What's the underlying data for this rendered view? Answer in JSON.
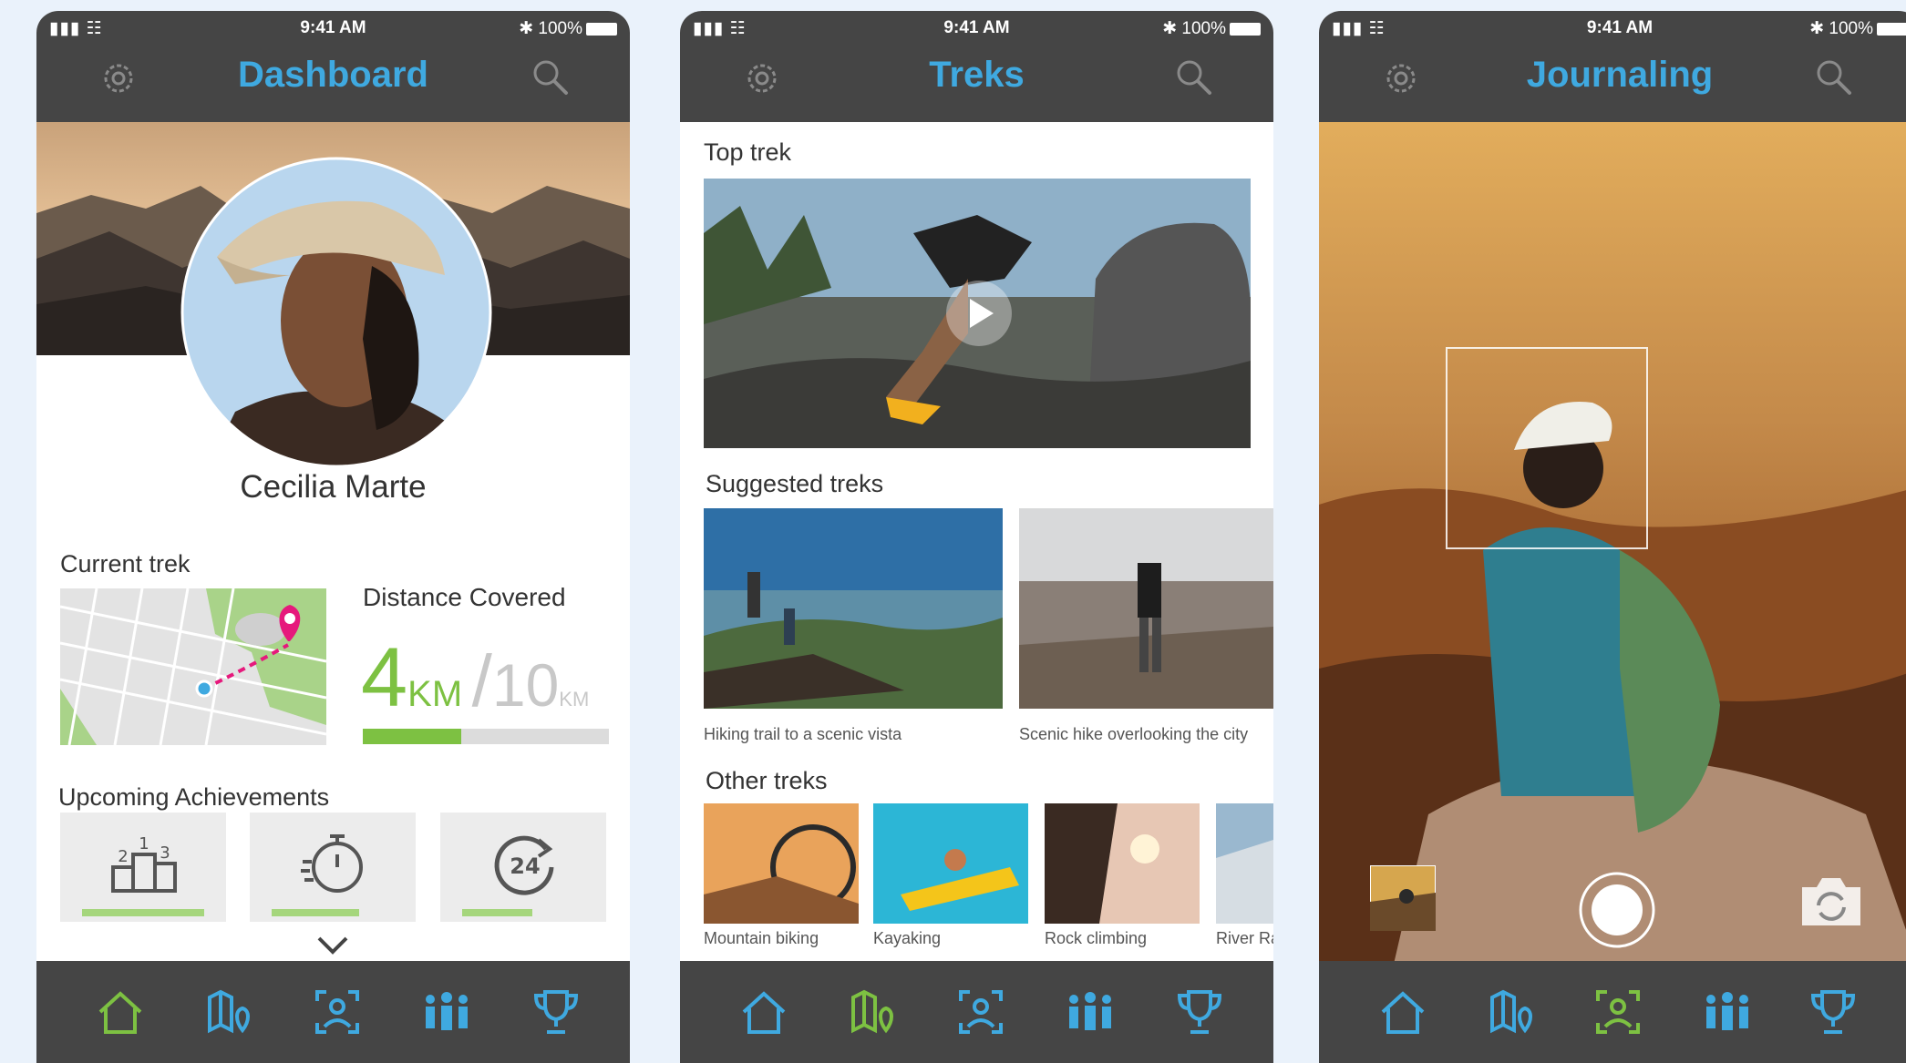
{
  "status": {
    "signal": "▮▮▮ ☷",
    "time": "9:41 AM",
    "battery": "✱ 100%"
  },
  "colors": {
    "accent_blue": "#3fa9e0",
    "accent_green": "#7dc142",
    "bar_dark": "#454545",
    "pin_pink": "#e6197c"
  },
  "dashboard": {
    "title": "Dashboard",
    "name": "Cecilia Marte",
    "current_trek_label": "Current trek",
    "distance_label": "Distance Covered",
    "distance_value": "4",
    "distance_unit": "KM",
    "distance_total": "10",
    "distance_total_unit": "KM",
    "distance_progress": 0.4,
    "achievements_label": "Upcoming Achievements",
    "achievements": [
      {
        "icon": "podium-icon",
        "progress": 0.7
      },
      {
        "icon": "stopwatch-icon",
        "progress": 0.5
      },
      {
        "icon": "24-hour-icon",
        "progress": 0.4
      }
    ]
  },
  "treks": {
    "title": "Treks",
    "top_label": "Top trek",
    "suggested_label": "Suggested treks",
    "suggested": [
      {
        "caption": "Hiking trail to a scenic vista"
      },
      {
        "caption": "Scenic hike overlooking the city"
      }
    ],
    "other_label": "Other treks",
    "other": [
      {
        "caption": "Mountain biking"
      },
      {
        "caption": "Kayaking"
      },
      {
        "caption": "Rock climbing"
      },
      {
        "caption": "River Ra"
      }
    ]
  },
  "journaling": {
    "title": "Journaling"
  },
  "nav": {
    "items": [
      "home-icon",
      "map-icon",
      "camera-scan-icon",
      "group-icon",
      "trophy-icon"
    ]
  }
}
